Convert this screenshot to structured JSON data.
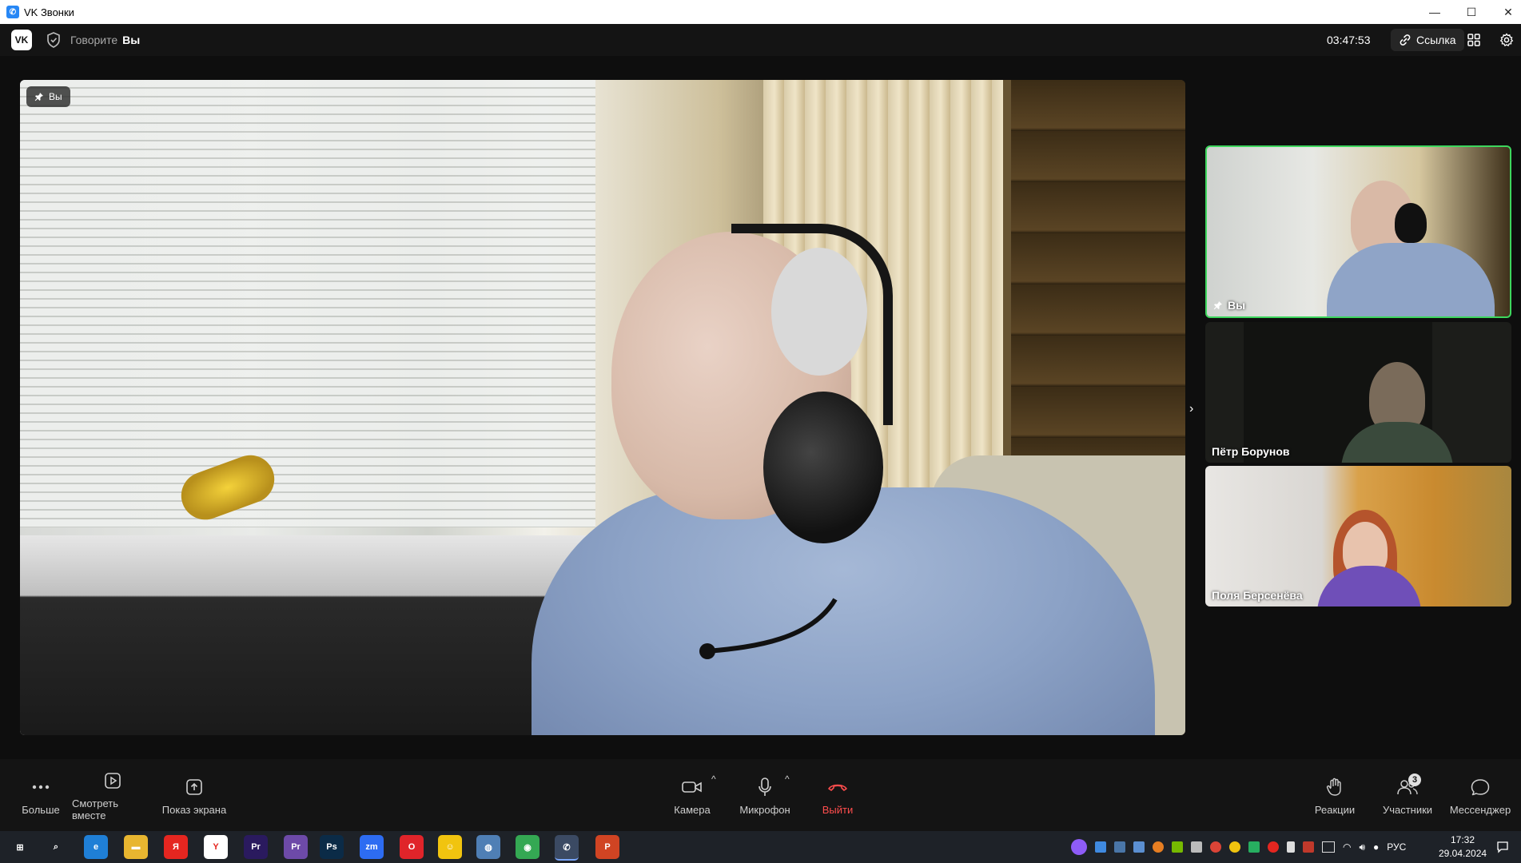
{
  "window": {
    "title": "VK Звонки",
    "minimize": "—",
    "maximize": "☐",
    "close": "✕"
  },
  "header": {
    "speaking_label": "Говорите",
    "speaking_name": "Вы",
    "timer": "03:47:53",
    "link_label": "Ссылка"
  },
  "main_video": {
    "name": "Вы"
  },
  "tiles": [
    {
      "name": "Вы",
      "active": true
    },
    {
      "name": "Пётр Борунов"
    },
    {
      "name": "Поля Берсенёва"
    }
  ],
  "controls": {
    "more": "Больше",
    "watch_together": "Смотреть вместе",
    "screen_share": "Показ экрана",
    "camera": "Камера",
    "microphone": "Микрофон",
    "exit": "Выйти",
    "reactions": "Реакции",
    "participants": "Участники",
    "participants_count": "3",
    "messenger": "Мессенджер"
  },
  "taskbar": {
    "apps": [
      {
        "name": "windows-start-icon",
        "label": "⊞",
        "color": "#1e2228"
      },
      {
        "name": "search-icon",
        "label": "⌕",
        "color": "#1e2228"
      },
      {
        "name": "edge-icon",
        "label": "e",
        "color": "#1f7fd6"
      },
      {
        "name": "explorer-icon",
        "label": "▬",
        "color": "#e8b630"
      },
      {
        "name": "yandex-icon",
        "label": "Я",
        "color": "#e52620"
      },
      {
        "name": "yandex-browser-icon",
        "label": "Y",
        "color": "#ffffff"
      },
      {
        "name": "premiere-icon",
        "label": "Pr",
        "color": "#2a1a5e"
      },
      {
        "name": "premiere-rush-icon",
        "label": "Pr",
        "color": "#6d4aa8"
      },
      {
        "name": "photoshop-icon",
        "label": "Ps",
        "color": "#0b2b47"
      },
      {
        "name": "zoom-icon",
        "label": "zm",
        "color": "#2d6cf2"
      },
      {
        "name": "opera-icon",
        "label": "O",
        "color": "#e0242a"
      },
      {
        "name": "smiley-app-icon",
        "label": "☺",
        "color": "#f1c40f"
      },
      {
        "name": "globe-app-icon",
        "label": "◍",
        "color": "#4f7fb5"
      },
      {
        "name": "chrome-icon",
        "label": "◉",
        "color": "#34a853"
      },
      {
        "name": "vk-calls-icon",
        "label": "✆",
        "color": "#3b4a63"
      },
      {
        "name": "powerpoint-icon",
        "label": "P",
        "color": "#d04423"
      }
    ],
    "language": "РУС",
    "time": "17:32",
    "date": "29.04.2024"
  }
}
